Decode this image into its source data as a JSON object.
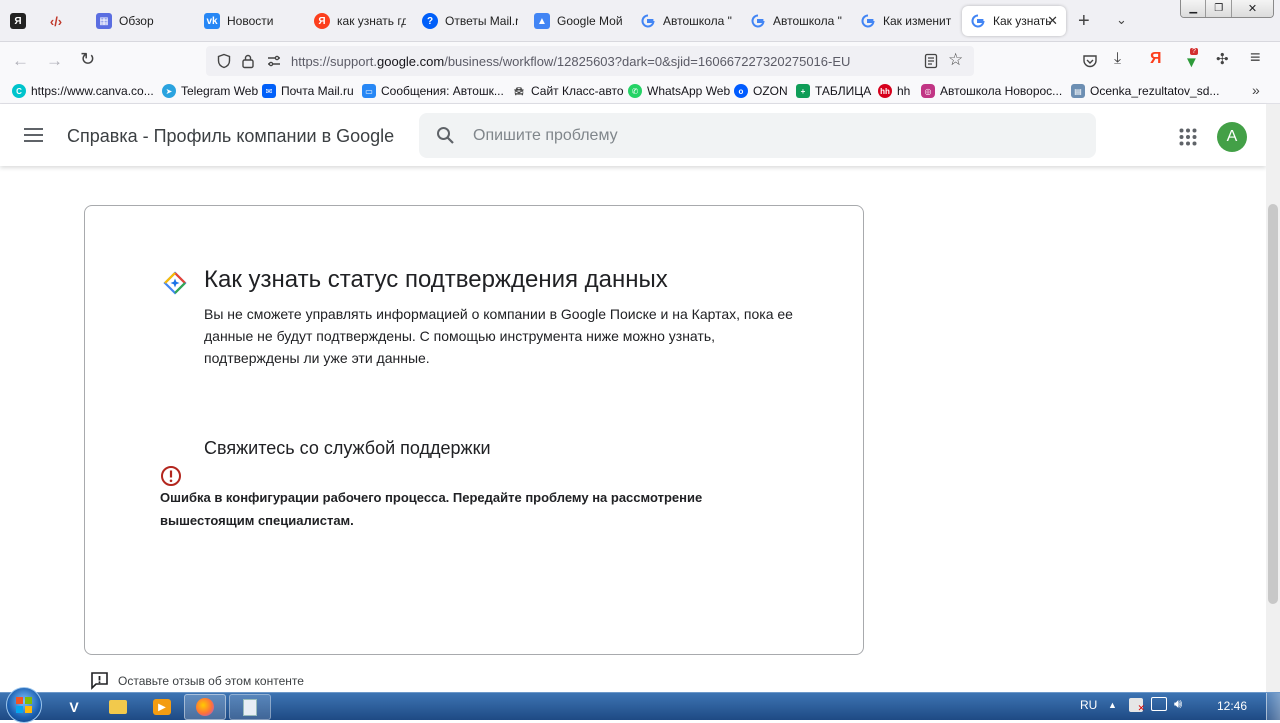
{
  "browser": {
    "tabs": [
      {
        "label": "",
        "icon": "yandex-icon",
        "color": "#222222"
      },
      {
        "label": "",
        "icon": "devtools-icon",
        "color": "#c0392b"
      },
      {
        "label": "Обзор",
        "icon": "overview-icon",
        "color": "#5b6ee1"
      },
      {
        "label": "Новости",
        "icon": "vk-icon",
        "color": "#2787f5"
      },
      {
        "label": "как узнать гд",
        "icon": "yandex-search-icon",
        "color": "#fc3f1d"
      },
      {
        "label": "Ответы Mail.r",
        "icon": "mail-answers-icon",
        "color": "#005ff9"
      },
      {
        "label": "Google Мой (",
        "icon": "google-mybusiness-icon",
        "color": "#4285f4"
      },
      {
        "label": "Автошкола \"",
        "icon": "google-icon",
        "color": "#ffffff"
      },
      {
        "label": "Автошкола \"",
        "icon": "google-icon",
        "color": "#ffffff"
      },
      {
        "label": "Как изменить",
        "icon": "google-icon",
        "color": "#ffffff"
      },
      {
        "label": "Как узнать",
        "icon": "google-icon",
        "color": "#ffffff",
        "active": true
      }
    ],
    "url_prefix": "https://support.",
    "url_domain": "google.com",
    "url_suffix": "/business/workflow/12825603?dark=0&sjid=16066722732027501​6-EU",
    "bookmarks": [
      {
        "label": "https://www.canva.co...",
        "icon": "canva-icon",
        "color": "#00c4cc"
      },
      {
        "label": "Telegram Web",
        "icon": "telegram-icon",
        "color": "#2aa3df"
      },
      {
        "label": "Почта Mail.ru",
        "icon": "mail-icon",
        "color": "#005ff9"
      },
      {
        "label": "Сообщения: Автошк...",
        "icon": "messages-icon",
        "color": "#2787f5"
      },
      {
        "label": "Сайт Класс-авто",
        "icon": "car-icon",
        "color": "#444444"
      },
      {
        "label": "WhatsApp Web",
        "icon": "whatsapp-icon",
        "color": "#25d366"
      },
      {
        "label": "OZON",
        "icon": "ozon-icon",
        "color": "#005bff"
      },
      {
        "label": "ТАБЛИЦА",
        "icon": "sheets-icon",
        "color": "#0f9d58"
      },
      {
        "label": "hh",
        "icon": "hh-icon",
        "color": "#d6001c"
      },
      {
        "label": "Автошкола Новорос...",
        "icon": "instagram-icon",
        "color": "#c13584"
      },
      {
        "label": "Ocenka_rezultatov_sd...",
        "icon": "folder-icon",
        "color": "#6d8fb3"
      }
    ]
  },
  "header": {
    "title": "Справка - Профиль компании в Google",
    "search_placeholder": "Опишите проблему",
    "avatar_letter": "A",
    "avatar_color": "#43a047"
  },
  "article": {
    "title": "Как узнать статус подтверждения данных",
    "body": "Вы не сможете управлять информацией о компании в Google Поиске и на Картах, пока ее данные не будут подтверждены. С помощью инструмента ниже можно узнать, подтверждены ли уже эти данные.",
    "section_title": "Свяжитесь со службой поддержки",
    "error_text": "Ошибка в конфигурации рабочего процесса. Передайте проблему на рассмотрение вышестоящим специалистам.",
    "error_color": "#b3261e"
  },
  "feedback": {
    "label": "Оставьте отзыв об этом контенте"
  },
  "taskbar": {
    "language": "RU",
    "time": "12:46",
    "apps": [
      "start-orb-icon",
      "vk-icon",
      "explorer-icon",
      "media-player-icon",
      "firefox-icon",
      "notepad-icon"
    ]
  }
}
